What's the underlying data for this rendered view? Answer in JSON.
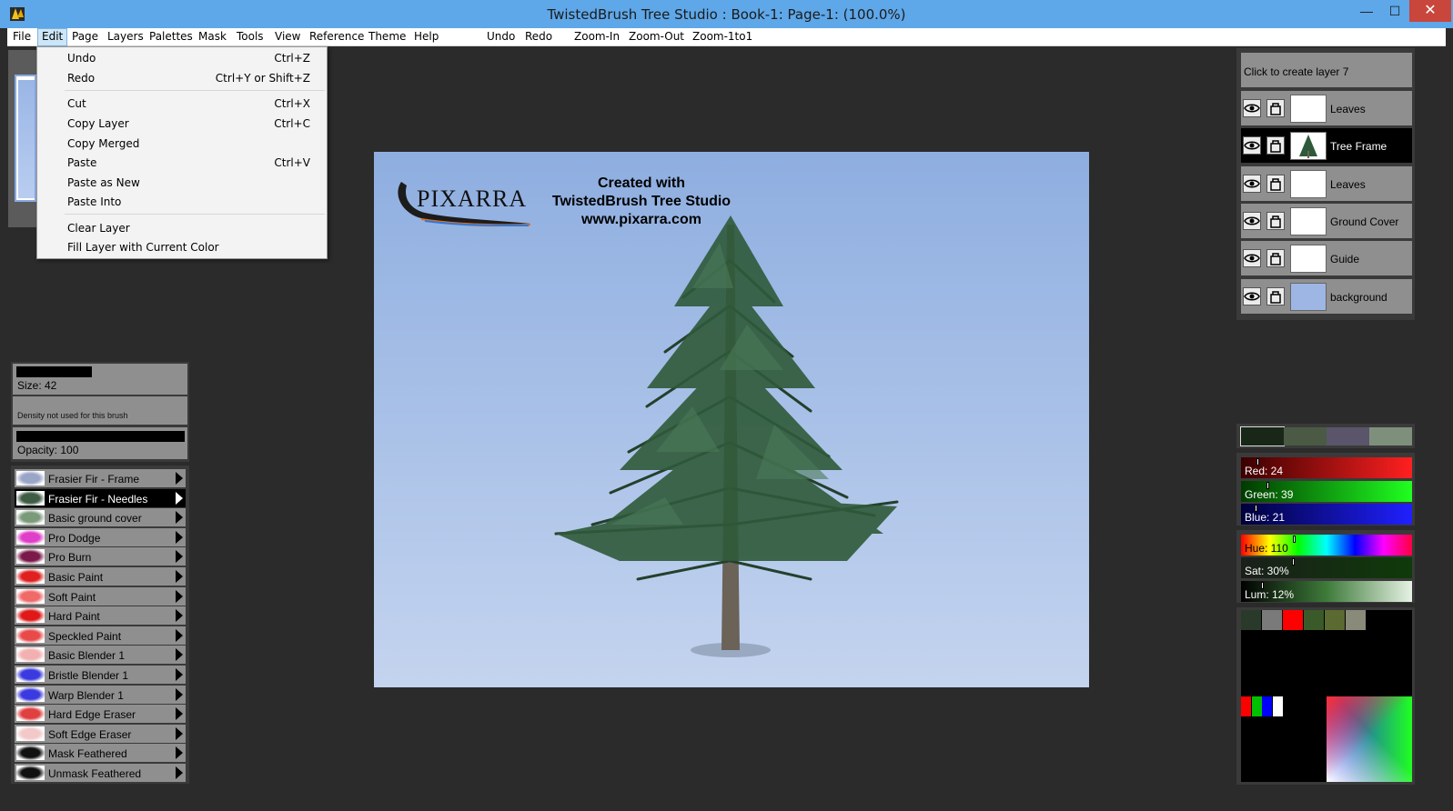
{
  "window": {
    "title": "TwistedBrush Tree Studio : Book-1: Page-1:  (100.0%)",
    "min_glyph": "—",
    "max_glyph": "☐",
    "close_glyph": "✕"
  },
  "menubar": {
    "items": [
      "File",
      "Edit",
      "Page",
      "Layers",
      "Palettes",
      "Mask",
      "Tools",
      "View",
      "Reference",
      "Theme",
      "Help"
    ],
    "toolbar": [
      "Undo",
      "Redo",
      "Zoom-In",
      "Zoom-Out",
      "Zoom-1to1"
    ]
  },
  "edit_menu": {
    "items": [
      {
        "label": "Undo",
        "shortcut": "Ctrl+Z"
      },
      {
        "label": "Redo",
        "shortcut": "Ctrl+Y or Shift+Z"
      },
      {
        "label": "Cut",
        "shortcut": "Ctrl+X"
      },
      {
        "label": "Copy Layer",
        "shortcut": "Ctrl+C"
      },
      {
        "label": "Copy Merged",
        "shortcut": ""
      },
      {
        "label": "Paste",
        "shortcut": "Ctrl+V"
      },
      {
        "label": "Paste as New",
        "shortcut": ""
      },
      {
        "label": "Paste Into",
        "shortcut": ""
      },
      {
        "label": "Clear Layer",
        "shortcut": ""
      },
      {
        "label": "Fill Layer with Current Color",
        "shortcut": ""
      }
    ]
  },
  "brush_settings": {
    "size": "Size: 42",
    "density": "Density not used for this brush",
    "opacity": "Opacity: 100"
  },
  "brushes": [
    {
      "label": "Frasier Fir - Frame",
      "swatch": "#9aa6c8"
    },
    {
      "label": "Frasier Fir - Needles",
      "swatch": "#3f5d45"
    },
    {
      "label": "Basic ground cover",
      "swatch": "#7a9a7a"
    },
    {
      "label": "Pro Dodge",
      "swatch": "#e03dc8"
    },
    {
      "label": "Pro Burn",
      "swatch": "#7b1a4a"
    },
    {
      "label": "Basic Paint",
      "swatch": "#e02020"
    },
    {
      "label": "Soft Paint",
      "swatch": "#f06a6a"
    },
    {
      "label": "Hard Paint",
      "swatch": "#e01818"
    },
    {
      "label": "Speckled Paint",
      "swatch": "#e84a4a"
    },
    {
      "label": "Basic Blender 1",
      "swatch": "#f3b0b0"
    },
    {
      "label": "Bristle Blender 1",
      "swatch": "#3a3ae0"
    },
    {
      "label": "Warp Blender 1",
      "swatch": "#3a3ae0"
    },
    {
      "label": "Hard Edge Eraser",
      "swatch": "#e04040"
    },
    {
      "label": "Soft Edge Eraser",
      "swatch": "#f2c8c8"
    },
    {
      "label": "Mask Feathered",
      "swatch": "#111111"
    },
    {
      "label": "Unmask Feathered",
      "swatch": "#111111"
    }
  ],
  "canvas": {
    "logo_text": "PIXARRA",
    "line1": "Created with",
    "line2": "TwistedBrush Tree Studio",
    "line3": "www.pixarra.com"
  },
  "layers": {
    "create_label": "Click to create layer 7",
    "items": [
      {
        "name": "Leaves",
        "thumb": "#ffffff"
      },
      {
        "name": "Tree Frame",
        "thumb": "#ffffff"
      },
      {
        "name": "Leaves",
        "thumb": "#ffffff"
      },
      {
        "name": "Ground Cover",
        "thumb": "#ffffff"
      },
      {
        "name": "Guide",
        "thumb": "#ffffff"
      },
      {
        "name": "background",
        "thumb": "#9db6e3"
      }
    ]
  },
  "color": {
    "swatches": [
      "#182717",
      "#4a5a44",
      "#5a556a",
      "#7e907c"
    ],
    "red": "Red: 24",
    "green": "Green: 39",
    "blue": "Blue: 21",
    "hue": "Hue: 110",
    "sat": "Sat: 30%",
    "lum": "Lum: 12%",
    "red_value": 24,
    "green_value": 39,
    "blue_value": 21,
    "hue_value": 110,
    "sat_value": 30,
    "lum_value": 12,
    "palette_top": [
      "#2a3a2a",
      "#7a7a7a",
      "#ff0000",
      "#3a5a2a",
      "#5a6a30",
      "#8a8a7a"
    ],
    "palette_rgbw": [
      "#ff0000",
      "#00c000",
      "#0000ff",
      "#ffffff"
    ]
  }
}
